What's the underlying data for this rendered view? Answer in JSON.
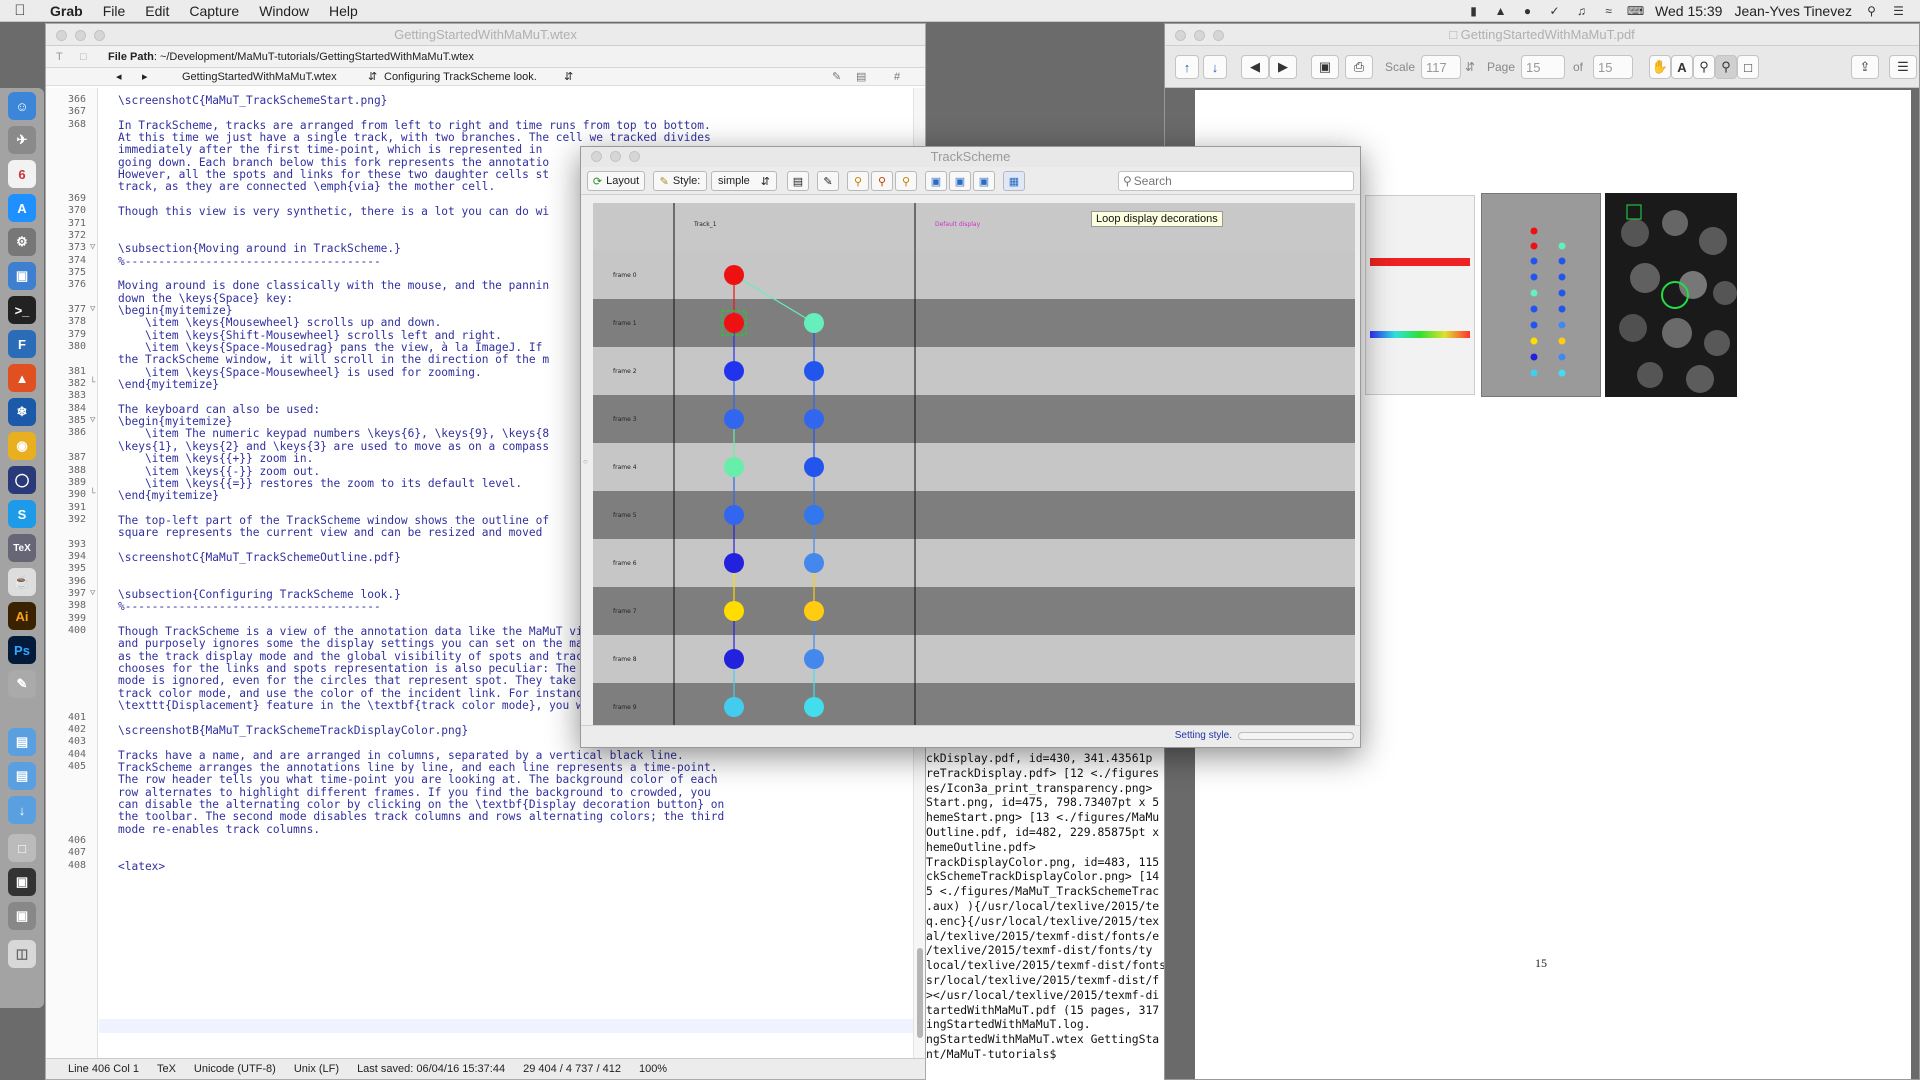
{
  "menubar": {
    "app": "Grab",
    "items": [
      "File",
      "Edit",
      "Capture",
      "Window",
      "Help"
    ],
    "clock": "Wed 15:39",
    "user": "Jean-Yves Tinevez"
  },
  "editor": {
    "title": "GettingStartedWithMaMuT.wtex",
    "path_label": "File Path",
    "path_value": ": ~/Development/MaMuT-tutorials/GettingStartedWithMaMuT.wtex",
    "tab_file": "GettingStartedWithMaMuT.wtex",
    "tab_section": "Configuring TrackScheme look.",
    "lines": [
      {
        "n": "366",
        "t": "\\screenshotC{MaMuT_TrackSchemeStart.png}"
      },
      {
        "n": "367",
        "t": ""
      },
      {
        "n": "368",
        "t": "In TrackScheme, tracks are arranged from left to right and time runs from top to bottom."
      },
      {
        "n": "",
        "t": "At this time we just have a single track, with two branches. The cell we tracked divides"
      },
      {
        "n": "",
        "t": "immediately after the first time-point, which is represented in"
      },
      {
        "n": "",
        "t": "going down. Each branch below this fork represents the annotatio"
      },
      {
        "n": "",
        "t": "However, all the spots and links for these two daughter cells st"
      },
      {
        "n": "",
        "t": "track, as they are connected \\emph{via} the mother cell."
      },
      {
        "n": "369",
        "t": ""
      },
      {
        "n": "370",
        "t": "Though this view is very synthetic, there is a lot you can do wi"
      },
      {
        "n": "371",
        "t": ""
      },
      {
        "n": "372",
        "t": ""
      },
      {
        "n": "373",
        "t": "\\subsection{Moving around in TrackScheme.}"
      },
      {
        "n": "374",
        "t": "%--------------------------------------"
      },
      {
        "n": "375",
        "t": ""
      },
      {
        "n": "376",
        "t": "Moving around is done classically with the mouse, and the pannin"
      },
      {
        "n": "",
        "t": "down the \\keys{Space} key:"
      },
      {
        "n": "377",
        "t": "\\begin{myitemize}"
      },
      {
        "n": "378",
        "t": "    \\item \\keys{Mousewheel} scrolls up and down."
      },
      {
        "n": "379",
        "t": "    \\item \\keys{Shift-Mousewheel} scrolls left and right."
      },
      {
        "n": "380",
        "t": "    \\item \\keys{Space-Mousedrag} pans the view, à la ImageJ. If"
      },
      {
        "n": "",
        "t": "the TrackScheme window, it will scroll in the direction of the m"
      },
      {
        "n": "381",
        "t": "    \\item \\keys{Space-Mousewheel} is used for zooming."
      },
      {
        "n": "382",
        "t": "\\end{myitemize}"
      },
      {
        "n": "383",
        "t": ""
      },
      {
        "n": "384",
        "t": "The keyboard can also be used:"
      },
      {
        "n": "385",
        "t": "\\begin{myitemize}"
      },
      {
        "n": "386",
        "t": "    \\item The numeric keypad numbers \\keys{6}, \\keys{9}, \\keys{8"
      },
      {
        "n": "",
        "t": "\\keys{1}, \\keys{2} and \\keys{3} are used to move as on a compass"
      },
      {
        "n": "387",
        "t": "    \\item \\keys{{+}} zoom in."
      },
      {
        "n": "388",
        "t": "    \\item \\keys{{-}} zoom out."
      },
      {
        "n": "389",
        "t": "    \\item \\keys{{=}} restores the zoom to its default level."
      },
      {
        "n": "390",
        "t": "\\end{myitemize}"
      },
      {
        "n": "391",
        "t": ""
      },
      {
        "n": "392",
        "t": "The top-left part of the TrackScheme window shows the outline of"
      },
      {
        "n": "",
        "t": "square represents the current view and can be resized and moved"
      },
      {
        "n": "393",
        "t": ""
      },
      {
        "n": "394",
        "t": "\\screenshotC{MaMuT_TrackSchemeOutline.pdf}"
      },
      {
        "n": "395",
        "t": ""
      },
      {
        "n": "396",
        "t": ""
      },
      {
        "n": "397",
        "t": "\\subsection{Configuring TrackScheme look.}"
      },
      {
        "n": "398",
        "t": "%--------------------------------------"
      },
      {
        "n": "399",
        "t": ""
      },
      {
        "n": "400",
        "t": "Though TrackScheme is a view of the annotation data like the MaMuT viewer, it completely"
      },
      {
        "n": "",
        "t": "and purposely ignores some the display settings you can set on the main GUI window, such"
      },
      {
        "n": "",
        "t": "as the track display mode and the global visibility of spots and tracks. The color it"
      },
      {
        "n": "",
        "t": "chooses for the links and spots representation is also peculiar: The spot color by feature"
      },
      {
        "n": "",
        "t": "mode is ignored, even for the circles that represent spot. They take their color from the"
      },
      {
        "n": "",
        "t": "track color mode, and use the color of the incident link. For instance, if you pick the"
      },
      {
        "n": "",
        "t": "\\texttt{Displacement} feature in the \\textbf{track color mode}, you will get this:"
      },
      {
        "n": "401",
        "t": ""
      },
      {
        "n": "402",
        "t": "\\screenshotB{MaMuT_TrackSchemeTrackDisplayColor.png}"
      },
      {
        "n": "403",
        "t": ""
      },
      {
        "n": "404",
        "t": "Tracks have a name, and are arranged in columns, separated by a vertical black line."
      },
      {
        "n": "405",
        "t": "TrackScheme arranges the annotations line by line, and each line represents a time-point."
      },
      {
        "n": "",
        "t": "The row header tells you what time-point you are looking at. The background color of each"
      },
      {
        "n": "",
        "t": "row alternates to highlight different frames. If you find the background to crowded, you"
      },
      {
        "n": "",
        "t": "can disable the alternating color by clicking on the \\textbf{Display decoration button} on"
      },
      {
        "n": "",
        "t": "the toolbar. The second mode disables track columns and rows alternating colors; the third"
      },
      {
        "n": "",
        "t": "mode re-enables track columns."
      },
      {
        "n": "406",
        "t": ""
      },
      {
        "n": "407",
        "t": ""
      },
      {
        "n": "408",
        "t": "<latex>"
      }
    ],
    "status": {
      "position": "Line 406 Col 1",
      "syntax": "TeX",
      "encoding": "Unicode (UTF-8)",
      "line_endings": "Unix (LF)",
      "saved": "Last saved: 06/04/16 15:37:44",
      "counts": "29 404 / 4 737 / 412",
      "zoom": "100%"
    }
  },
  "terminal": {
    "lines": [
      "ckDisplay.pdf, id=430, 341.43561p",
      "reTrackDisplay.pdf> [12 <./figures",
      "es/Icon3a_print_transparency.png>",
      "Start.png, id=475, 798.73407pt x 5",
      "hemeStart.png> [13 <./figures/MaMu",
      "",
      "Outline.pdf, id=482, 229.85875pt x",
      "hemeOutline.pdf>",
      "TrackDisplayColor.png, id=483, 115",
      "ckSchemeTrackDisplayColor.png> [14",
      "5 <./figures/MaMuT_TrackSchemeTrac",
      ".aux) ){/usr/local/texlive/2015/te",
      "q.enc}{/usr/local/texlive/2015/tex",
      "al/texlive/2015/texmf-dist/fonts/e",
      "/texlive/2015/texmf-dist/fonts/ty",
      "local/texlive/2015/texmf-dist/fonts",
      "sr/local/texlive/2015/texmf-dist/f",
      "></usr/local/texlive/2015/texmf-di",
      "",
      "tartedWithMaMuT.pdf (15 pages, 317",
      "ingStartedWithMaMuT.log.",
      "ngStartedWithMaMuT.wtex GettingSta",
      "nt/MaMuT-tutorials$ "
    ]
  },
  "pdf": {
    "title": "GettingStartedWithMaMuT.pdf",
    "scale_label": "Scale",
    "scale_value": "117",
    "page_label": "Page",
    "page_value": "15",
    "of_label": "of",
    "of_value": "15",
    "page_number": "15"
  },
  "trackscheme": {
    "title": "TrackScheme",
    "layout_label": "Layout",
    "style_label": "Style:",
    "style_value": "simple",
    "search_placeholder": "Search",
    "tooltip": "Loop display decorations",
    "track_name": "Track_1",
    "column2_label": "Default display",
    "status": "Setting style.",
    "frames": [
      "frame 0",
      "frame 1",
      "frame 2",
      "frame 3",
      "frame 4",
      "frame 5",
      "frame 6",
      "frame 7",
      "frame 8",
      "frame 9"
    ],
    "spots_left": [
      "#ee1111",
      "#ee1111",
      "#2233ee",
      "#3366ee",
      "#66eeaa",
      "#3366ee",
      "#2222dd",
      "#ffdd00",
      "#2222dd",
      "#44ccee"
    ],
    "spots_right": [
      "",
      "#66eebb",
      "#2255ee",
      "#3366ee",
      "#2255ee",
      "#3377ee",
      "#4488ee",
      "#ffcc11",
      "#4488ee",
      "#44ddee"
    ]
  }
}
